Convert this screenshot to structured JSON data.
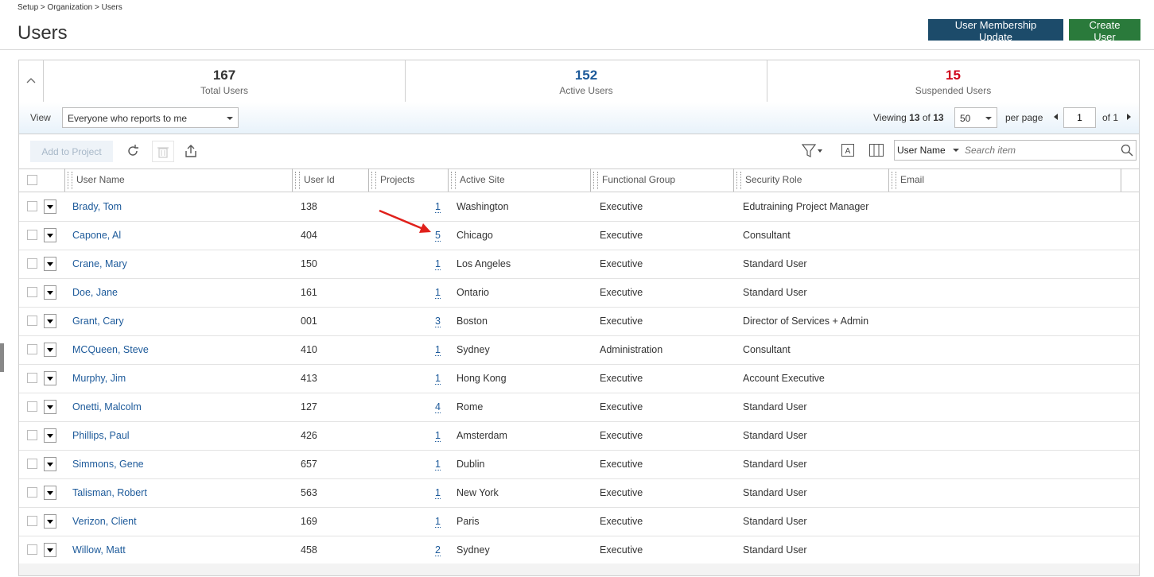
{
  "breadcrumb": "Setup > Organization > Users",
  "page_title": "Users",
  "buttons": {
    "membership": "User Membership Update",
    "create": "Create User"
  },
  "stats": [
    {
      "value": "167",
      "label": "Total Users",
      "color": "#222222"
    },
    {
      "value": "152",
      "label": "Active Users",
      "color": "#1d5a9a"
    },
    {
      "value": "15",
      "label": "Suspended Users",
      "color": "#d0021b"
    }
  ],
  "view": {
    "label": "View",
    "selected": "Everyone who reports to me"
  },
  "paging": {
    "viewing": "Viewing",
    "current": "13",
    "of_word": "of",
    "total": "13",
    "per_page_value": "50",
    "per_page_label": "per page",
    "page": "1",
    "of_pages": "of 1"
  },
  "toolbar": {
    "add_to_project": "Add to Project",
    "search_field": "User Name",
    "search_placeholder": "Search item"
  },
  "columns": [
    "User Name",
    "User Id",
    "Projects",
    "Active Site",
    "Functional Group",
    "Security Role",
    "Email"
  ],
  "rows": [
    {
      "name": "Brady, Tom",
      "id": "138",
      "projects": "1",
      "site": "Washington",
      "group": "Executive",
      "role": "Edutraining Project Manager"
    },
    {
      "name": "Capone, Al",
      "id": "404",
      "projects": "5",
      "site": "Chicago",
      "group": "Executive",
      "role": "Consultant"
    },
    {
      "name": "Crane, Mary",
      "id": "150",
      "projects": "1",
      "site": "Los Angeles",
      "group": "Executive",
      "role": "Standard User"
    },
    {
      "name": "Doe, Jane",
      "id": "161",
      "projects": "1",
      "site": "Ontario",
      "group": "Executive",
      "role": "Standard User"
    },
    {
      "name": "Grant, Cary",
      "id": "001",
      "projects": "3",
      "site": "Boston",
      "group": "Executive",
      "role": "Director of Services + Admin"
    },
    {
      "name": "MCQueen, Steve",
      "id": "410",
      "projects": "1",
      "site": "Sydney",
      "group": "Administration",
      "role": "Consultant"
    },
    {
      "name": "Murphy, Jim",
      "id": "413",
      "projects": "1",
      "site": "Hong Kong",
      "group": "Executive",
      "role": "Account Executive"
    },
    {
      "name": "Onetti, Malcolm",
      "id": "127",
      "projects": "4",
      "site": "Rome",
      "group": "Executive",
      "role": "Standard User"
    },
    {
      "name": "Phillips, Paul",
      "id": "426",
      "projects": "1",
      "site": "Amsterdam",
      "group": "Executive",
      "role": "Standard User"
    },
    {
      "name": "Simmons, Gene",
      "id": "657",
      "projects": "1",
      "site": "Dublin",
      "group": "Executive",
      "role": "Standard User"
    },
    {
      "name": "Talisman, Robert",
      "id": "563",
      "projects": "1",
      "site": "New York",
      "group": "Executive",
      "role": "Standard User"
    },
    {
      "name": "Verizon, Client",
      "id": "169",
      "projects": "1",
      "site": "Paris",
      "group": "Executive",
      "role": "Standard User"
    },
    {
      "name": "Willow, Matt",
      "id": "458",
      "projects": "2",
      "site": "Sydney",
      "group": "Executive",
      "role": "Standard User"
    }
  ],
  "annotation_arrow_color": "#e0201b"
}
